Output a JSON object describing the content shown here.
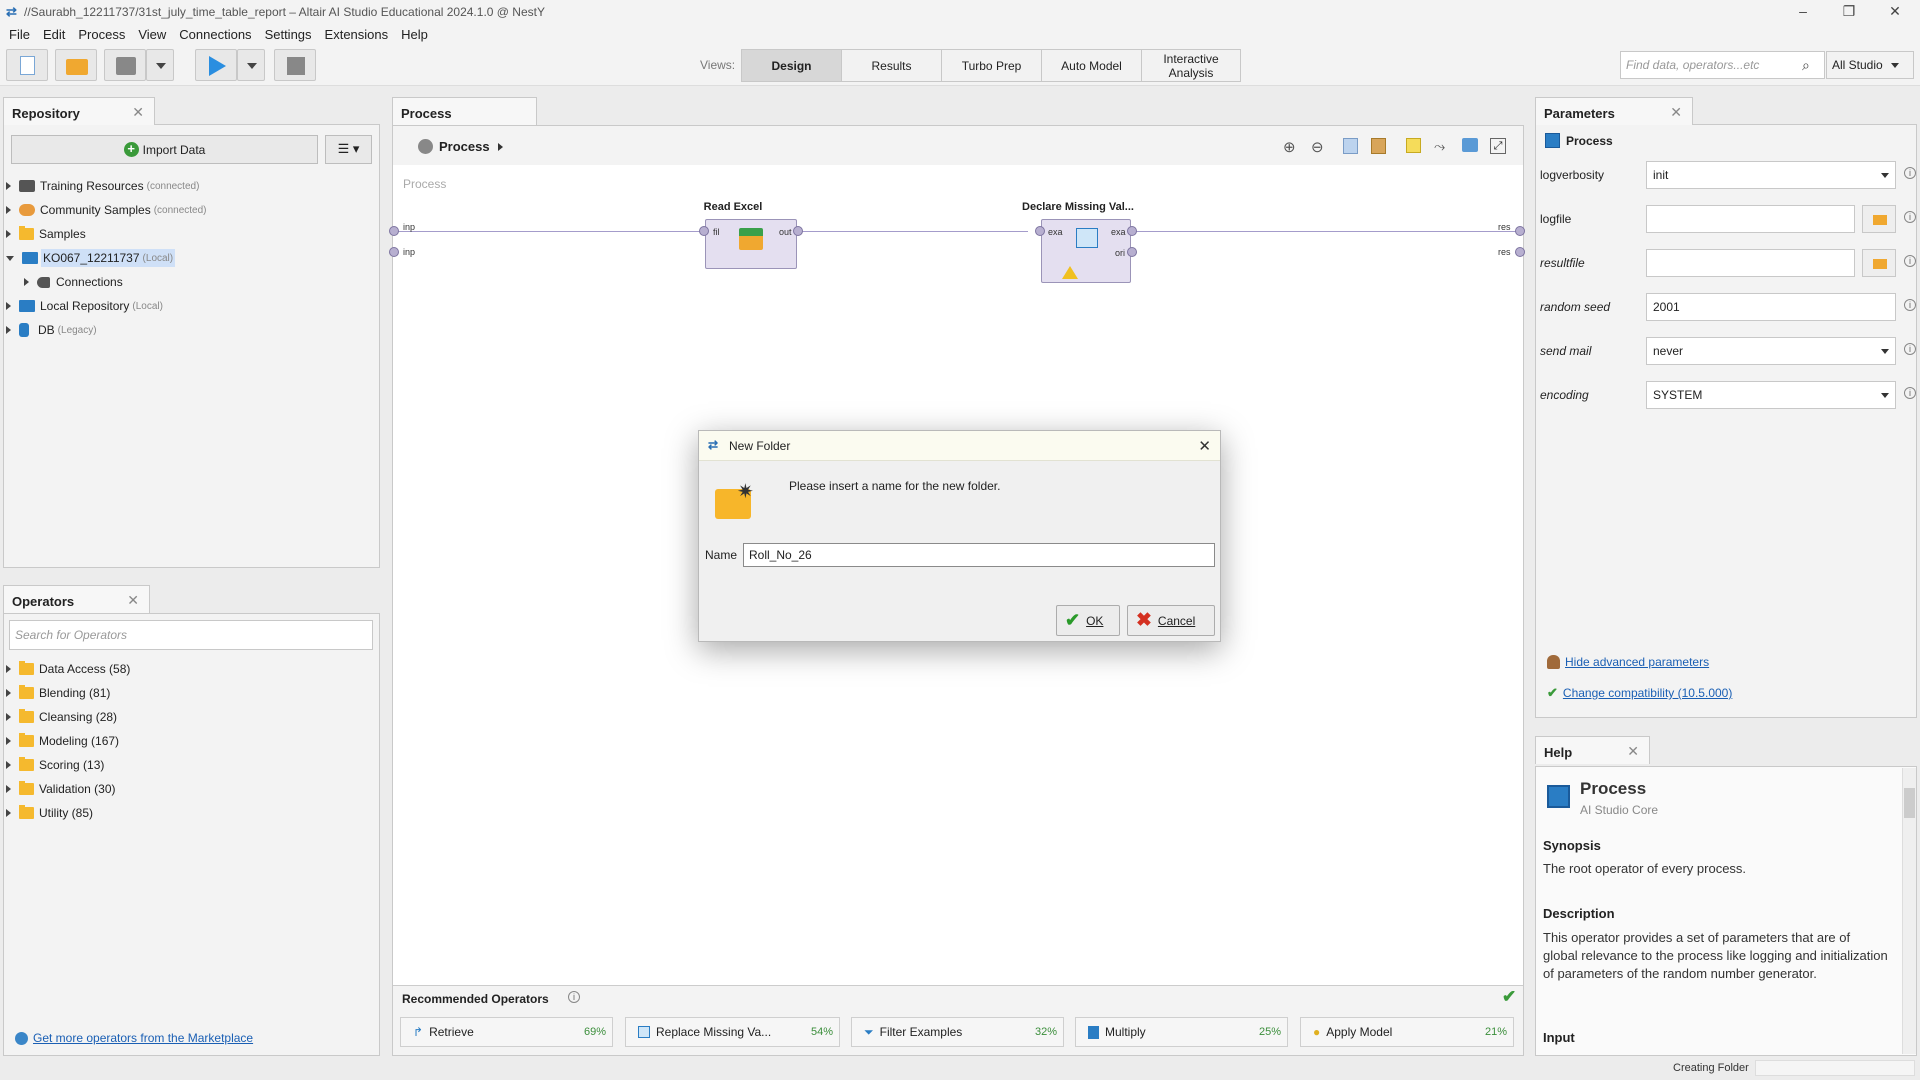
{
  "window": {
    "title": "//Saurabh_12211737/31st_july_time_table_report – Altair AI Studio Educational 2024.1.0 @ NestY"
  },
  "menu": [
    "File",
    "Edit",
    "Process",
    "View",
    "Connections",
    "Settings",
    "Extensions",
    "Help"
  ],
  "views": {
    "label": "Views:",
    "tabs": [
      "Design",
      "Results",
      "Turbo Prep",
      "Auto Model",
      "Interactive Analysis"
    ],
    "active": "Design"
  },
  "search": {
    "placeholder": "Find data, operators...etc",
    "scope": "All Studio"
  },
  "repository": {
    "title": "Repository",
    "import_label": "Import Data",
    "items": [
      {
        "label": "Training Resources",
        "note": "(connected)",
        "icon": "graduation-icon"
      },
      {
        "label": "Community Samples",
        "note": "(connected)",
        "icon": "community-icon"
      },
      {
        "label": "Samples",
        "note": "",
        "icon": "folder-icon"
      },
      {
        "label": "KO067_12211737",
        "note": "(Local)",
        "icon": "monitor-icon",
        "expanded": true,
        "selected": true
      },
      {
        "label": "Connections",
        "note": "",
        "icon": "plug-icon",
        "child": true
      },
      {
        "label": "Local Repository",
        "note": "(Local)",
        "icon": "monitor-icon"
      },
      {
        "label": "DB",
        "note": "(Legacy)",
        "icon": "database-icon"
      }
    ]
  },
  "operators": {
    "title": "Operators",
    "search_placeholder": "Search for Operators",
    "items": [
      "Data Access (58)",
      "Blending (81)",
      "Cleansing (28)",
      "Modeling (167)",
      "Scoring (13)",
      "Validation (30)",
      "Utility (85)"
    ],
    "marketplace_link": "Get more operators from the Marketplace"
  },
  "process": {
    "tab": "Process",
    "breadcrumb": "Process",
    "canvas_label": "Process",
    "operators": [
      {
        "name": "Read Excel",
        "in": [
          "fil"
        ],
        "out": [
          "out"
        ]
      },
      {
        "name": "Declare Missing Val...",
        "in": [
          "exa"
        ],
        "out": [
          "exa",
          "ori"
        ]
      }
    ],
    "ports_left": [
      "inp",
      "inp"
    ],
    "ports_right": [
      "res",
      "res"
    ]
  },
  "recommended": {
    "title": "Recommended Operators",
    "items": [
      {
        "label": "Retrieve",
        "pct": "69%"
      },
      {
        "label": "Replace Missing Va...",
        "pct": "54%"
      },
      {
        "label": "Filter Examples",
        "pct": "32%"
      },
      {
        "label": "Multiply",
        "pct": "25%"
      },
      {
        "label": "Apply Model",
        "pct": "21%"
      }
    ]
  },
  "parameters": {
    "title": "Parameters",
    "context": "Process",
    "rows": [
      {
        "label": "logverbosity",
        "value": "init",
        "type": "dropdown"
      },
      {
        "label": "logfile",
        "value": "",
        "type": "file"
      },
      {
        "label": "resultfile",
        "value": "",
        "type": "file"
      },
      {
        "label": "random seed",
        "value": "2001",
        "type": "text"
      },
      {
        "label": "send mail",
        "value": "never",
        "type": "dropdown"
      },
      {
        "label": "encoding",
        "value": "SYSTEM",
        "type": "dropdown"
      }
    ],
    "hide_advanced": "Hide advanced parameters",
    "compat": "Change compatibility (10.5.000)"
  },
  "help": {
    "title": "Help",
    "op_name": "Process",
    "op_source": "AI Studio Core",
    "synopsis_h": "Synopsis",
    "synopsis": "The root operator of every process.",
    "description_h": "Description",
    "description": "This operator provides a set of parameters that are of global relevance to the process like logging and initialization of parameters of the random number generator.",
    "input_h": "Input"
  },
  "dialog": {
    "title": "New Folder",
    "message": "Please insert a name for the new folder.",
    "name_label": "Name",
    "name_value": "Roll_No_26",
    "ok": "OK",
    "cancel": "Cancel"
  },
  "status": {
    "text": "Creating Folder"
  },
  "colors": {
    "accent": "#1a5fb4",
    "selected": "#cfe0f7",
    "operator": "#e4dff0"
  }
}
